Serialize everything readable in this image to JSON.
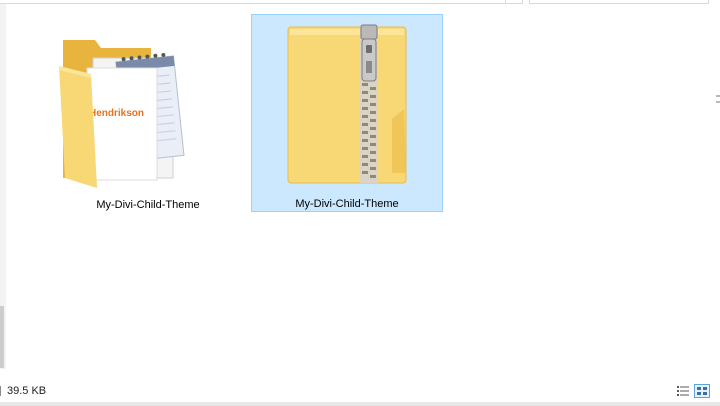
{
  "window": {
    "files": [
      {
        "name": "My-Divi-Child-Theme",
        "type": "folder",
        "icon": "folder-with-document-icon",
        "thumbnail_text": "Hendrikson",
        "selected": false
      },
      {
        "name": "My-Divi-Child-Theme",
        "type": "zip",
        "icon": "zipped-folder-icon",
        "selected": true
      }
    ],
    "status": {
      "size": "39.5 KB"
    },
    "views": {
      "details": "details-view-icon",
      "large_icons": "large-icons-view-icon",
      "active": "large_icons"
    },
    "colors": {
      "selection_bg": "#cce8ff",
      "selection_border": "#99d1ff",
      "folder_yellow": "#f8d775",
      "folder_back": "#e8b43d",
      "brand_orange": "#e8721c"
    }
  }
}
